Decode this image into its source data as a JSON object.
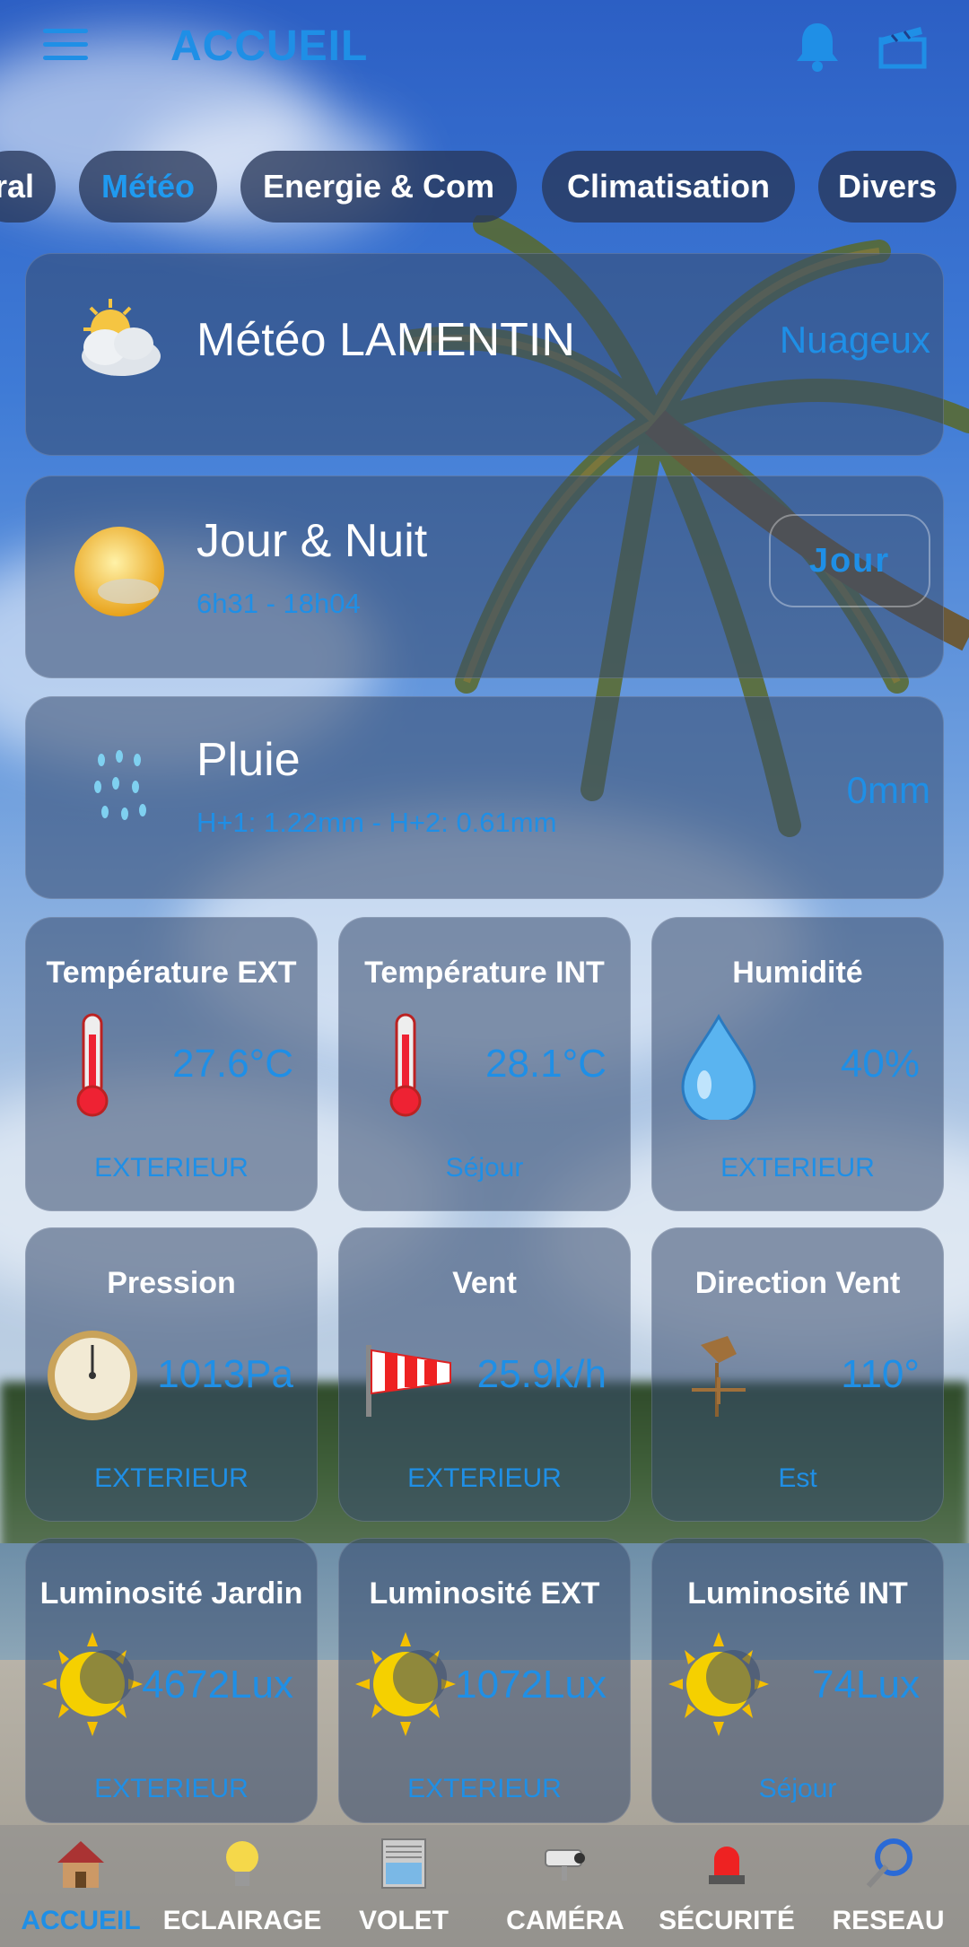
{
  "header": {
    "title": "ACCUEIL"
  },
  "tabs": [
    {
      "label": "ral",
      "active": false
    },
    {
      "label": "Météo",
      "active": true
    },
    {
      "label": "Energie & Com",
      "active": false
    },
    {
      "label": "Climatisation",
      "active": false
    },
    {
      "label": "Divers",
      "active": false
    }
  ],
  "cards": {
    "meteo": {
      "title": "Météo LAMENTIN",
      "value": "Nuageux"
    },
    "jour_nuit": {
      "title": "Jour & Nuit",
      "sub": "6h31 - 18h04",
      "button": "Jour"
    },
    "pluie": {
      "title": "Pluie",
      "sub": "H+1: 1.22mm - H+2: 0.61mm",
      "value": "0mm"
    }
  },
  "tiles": [
    {
      "title": "Température EXT",
      "value": "27.6°C",
      "location": "EXTERIEUR",
      "icon": "thermometer-icon"
    },
    {
      "title": "Température INT",
      "value": "28.1°C",
      "location": "Séjour",
      "icon": "thermometer-icon"
    },
    {
      "title": "Humidité",
      "value": "40%",
      "location": "EXTERIEUR",
      "icon": "water-drop-icon"
    },
    {
      "title": "Pression",
      "value": "1013Pa",
      "location": "EXTERIEUR",
      "icon": "barometer-icon"
    },
    {
      "title": "Vent",
      "value": "25.9k/h",
      "location": "EXTERIEUR",
      "icon": "windsock-icon"
    },
    {
      "title": "Direction Vent",
      "value": "110°",
      "location": "Est",
      "icon": "weather-vane-icon"
    },
    {
      "title": "Luminosité Jardin",
      "value": "4672Lux",
      "location": "EXTERIEUR",
      "icon": "sun-moon-icon"
    },
    {
      "title": "Luminosité EXT",
      "value": "1072Lux",
      "location": "EXTERIEUR",
      "icon": "sun-moon-icon"
    },
    {
      "title": "Luminosité INT",
      "value": "74Lux",
      "location": "Séjour",
      "icon": "sun-moon-icon"
    }
  ],
  "nav": [
    {
      "label": "ACCUEIL",
      "active": true,
      "icon": "house-icon"
    },
    {
      "label": "ECLAIRAGE",
      "active": false,
      "icon": "light-bulb-icon"
    },
    {
      "label": "VOLET",
      "active": false,
      "icon": "shutter-icon"
    },
    {
      "label": "CAMÉRA",
      "active": false,
      "icon": "camera-icon"
    },
    {
      "label": "SÉCURITÉ",
      "active": false,
      "icon": "alarm-icon"
    },
    {
      "label": "RESEAU",
      "active": false,
      "icon": "network-icon"
    }
  ],
  "colors": {
    "accent": "#1f8fe6",
    "card": "#374b6e"
  }
}
